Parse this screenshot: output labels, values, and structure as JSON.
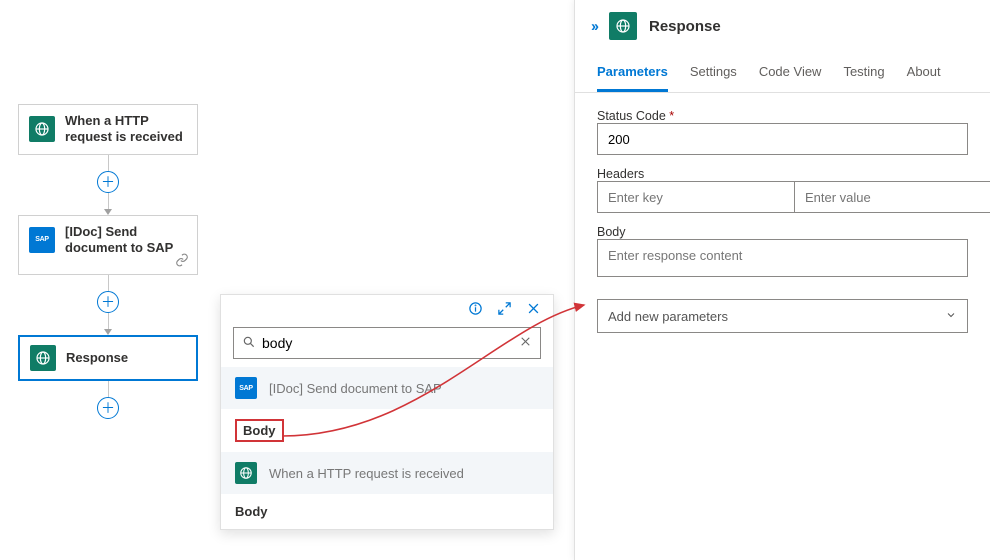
{
  "flow": {
    "nodes": [
      {
        "id": "trigger",
        "label": "When a HTTP request is received"
      },
      {
        "id": "sap",
        "label": "[IDoc] Send document to SAP"
      },
      {
        "id": "response",
        "label": "Response"
      }
    ]
  },
  "picker": {
    "search_value": "body",
    "groups": [
      {
        "type": "sap",
        "heading": "[IDoc] Send document to SAP",
        "item": "Body"
      },
      {
        "type": "request",
        "heading": "When a HTTP request is received",
        "item": "Body"
      }
    ]
  },
  "panel": {
    "title": "Response",
    "tabs": [
      "Parameters",
      "Settings",
      "Code View",
      "Testing",
      "About"
    ],
    "active_tab": "Parameters",
    "status_code_label": "Status Code",
    "status_code_value": "200",
    "headers_label": "Headers",
    "header_key_placeholder": "Enter key",
    "header_value_placeholder": "Enter value",
    "body_label": "Body",
    "body_placeholder": "Enter response content",
    "add_param_label": "Add new parameters"
  }
}
